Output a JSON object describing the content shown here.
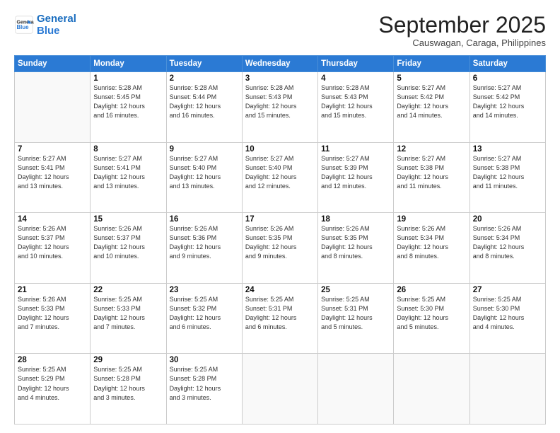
{
  "logo": {
    "line1": "General",
    "line2": "Blue"
  },
  "header": {
    "month": "September 2025",
    "location": "Causwagan, Caraga, Philippines"
  },
  "weekdays": [
    "Sunday",
    "Monday",
    "Tuesday",
    "Wednesday",
    "Thursday",
    "Friday",
    "Saturday"
  ],
  "weeks": [
    [
      {
        "day": "",
        "info": ""
      },
      {
        "day": "1",
        "info": "Sunrise: 5:28 AM\nSunset: 5:45 PM\nDaylight: 12 hours\nand 16 minutes."
      },
      {
        "day": "2",
        "info": "Sunrise: 5:28 AM\nSunset: 5:44 PM\nDaylight: 12 hours\nand 16 minutes."
      },
      {
        "day": "3",
        "info": "Sunrise: 5:28 AM\nSunset: 5:43 PM\nDaylight: 12 hours\nand 15 minutes."
      },
      {
        "day": "4",
        "info": "Sunrise: 5:28 AM\nSunset: 5:43 PM\nDaylight: 12 hours\nand 15 minutes."
      },
      {
        "day": "5",
        "info": "Sunrise: 5:27 AM\nSunset: 5:42 PM\nDaylight: 12 hours\nand 14 minutes."
      },
      {
        "day": "6",
        "info": "Sunrise: 5:27 AM\nSunset: 5:42 PM\nDaylight: 12 hours\nand 14 minutes."
      }
    ],
    [
      {
        "day": "7",
        "info": "Sunrise: 5:27 AM\nSunset: 5:41 PM\nDaylight: 12 hours\nand 13 minutes."
      },
      {
        "day": "8",
        "info": "Sunrise: 5:27 AM\nSunset: 5:41 PM\nDaylight: 12 hours\nand 13 minutes."
      },
      {
        "day": "9",
        "info": "Sunrise: 5:27 AM\nSunset: 5:40 PM\nDaylight: 12 hours\nand 13 minutes."
      },
      {
        "day": "10",
        "info": "Sunrise: 5:27 AM\nSunset: 5:40 PM\nDaylight: 12 hours\nand 12 minutes."
      },
      {
        "day": "11",
        "info": "Sunrise: 5:27 AM\nSunset: 5:39 PM\nDaylight: 12 hours\nand 12 minutes."
      },
      {
        "day": "12",
        "info": "Sunrise: 5:27 AM\nSunset: 5:38 PM\nDaylight: 12 hours\nand 11 minutes."
      },
      {
        "day": "13",
        "info": "Sunrise: 5:27 AM\nSunset: 5:38 PM\nDaylight: 12 hours\nand 11 minutes."
      }
    ],
    [
      {
        "day": "14",
        "info": "Sunrise: 5:26 AM\nSunset: 5:37 PM\nDaylight: 12 hours\nand 10 minutes."
      },
      {
        "day": "15",
        "info": "Sunrise: 5:26 AM\nSunset: 5:37 PM\nDaylight: 12 hours\nand 10 minutes."
      },
      {
        "day": "16",
        "info": "Sunrise: 5:26 AM\nSunset: 5:36 PM\nDaylight: 12 hours\nand 9 minutes."
      },
      {
        "day": "17",
        "info": "Sunrise: 5:26 AM\nSunset: 5:35 PM\nDaylight: 12 hours\nand 9 minutes."
      },
      {
        "day": "18",
        "info": "Sunrise: 5:26 AM\nSunset: 5:35 PM\nDaylight: 12 hours\nand 8 minutes."
      },
      {
        "day": "19",
        "info": "Sunrise: 5:26 AM\nSunset: 5:34 PM\nDaylight: 12 hours\nand 8 minutes."
      },
      {
        "day": "20",
        "info": "Sunrise: 5:26 AM\nSunset: 5:34 PM\nDaylight: 12 hours\nand 8 minutes."
      }
    ],
    [
      {
        "day": "21",
        "info": "Sunrise: 5:26 AM\nSunset: 5:33 PM\nDaylight: 12 hours\nand 7 minutes."
      },
      {
        "day": "22",
        "info": "Sunrise: 5:25 AM\nSunset: 5:33 PM\nDaylight: 12 hours\nand 7 minutes."
      },
      {
        "day": "23",
        "info": "Sunrise: 5:25 AM\nSunset: 5:32 PM\nDaylight: 12 hours\nand 6 minutes."
      },
      {
        "day": "24",
        "info": "Sunrise: 5:25 AM\nSunset: 5:31 PM\nDaylight: 12 hours\nand 6 minutes."
      },
      {
        "day": "25",
        "info": "Sunrise: 5:25 AM\nSunset: 5:31 PM\nDaylight: 12 hours\nand 5 minutes."
      },
      {
        "day": "26",
        "info": "Sunrise: 5:25 AM\nSunset: 5:30 PM\nDaylight: 12 hours\nand 5 minutes."
      },
      {
        "day": "27",
        "info": "Sunrise: 5:25 AM\nSunset: 5:30 PM\nDaylight: 12 hours\nand 4 minutes."
      }
    ],
    [
      {
        "day": "28",
        "info": "Sunrise: 5:25 AM\nSunset: 5:29 PM\nDaylight: 12 hours\nand 4 minutes."
      },
      {
        "day": "29",
        "info": "Sunrise: 5:25 AM\nSunset: 5:28 PM\nDaylight: 12 hours\nand 3 minutes."
      },
      {
        "day": "30",
        "info": "Sunrise: 5:25 AM\nSunset: 5:28 PM\nDaylight: 12 hours\nand 3 minutes."
      },
      {
        "day": "",
        "info": ""
      },
      {
        "day": "",
        "info": ""
      },
      {
        "day": "",
        "info": ""
      },
      {
        "day": "",
        "info": ""
      }
    ]
  ]
}
